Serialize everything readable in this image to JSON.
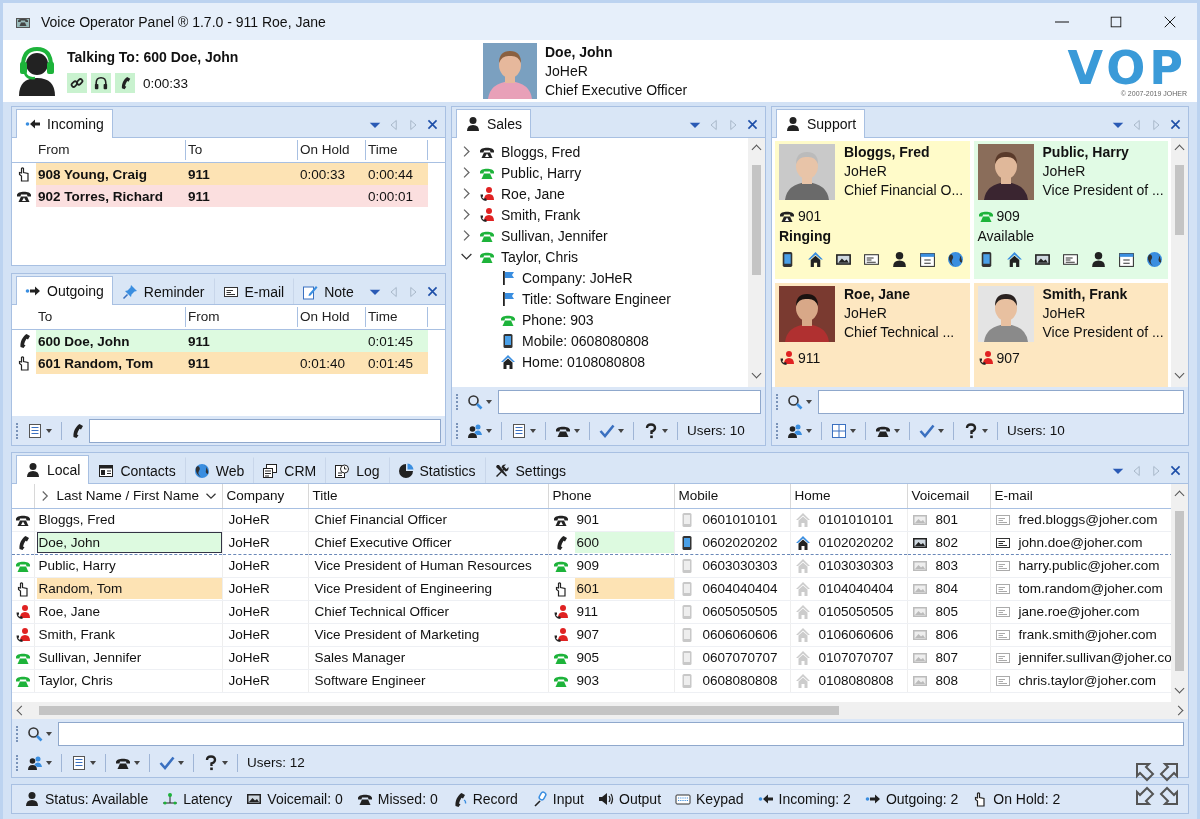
{
  "window": {
    "title": "Voice Operator Panel ® 1.7.0 - 911 Roe, Jane"
  },
  "header": {
    "talking_to": "Talking To: 600 Doe, John",
    "timer": "0:00:33",
    "contact": {
      "name": "Doe, John",
      "company": "JoHeR",
      "title": "Chief Executive Officer"
    },
    "logo": "VOP",
    "copyright": "© 2007-2019 JOHER"
  },
  "incoming": {
    "tabs": [
      {
        "label": "Incoming",
        "selected": true
      }
    ],
    "columns": [
      "From",
      "To",
      "On Hold",
      "Time"
    ],
    "rows": [
      {
        "kind": "hold",
        "from": "908 Young, Craig",
        "to": "911",
        "on_hold": "0:00:33",
        "time": "0:00:44"
      },
      {
        "kind": "ringing",
        "from": "902 Torres, Richard",
        "to": "911",
        "time": "0:00:01"
      }
    ]
  },
  "outgoing": {
    "tabs": [
      {
        "label": "Outgoing",
        "selected": true
      },
      {
        "label": "Reminder",
        "selected": false
      },
      {
        "label": "E-mail",
        "selected": false
      },
      {
        "label": "Note",
        "selected": false
      }
    ],
    "columns": [
      "To",
      "From",
      "On Hold",
      "Time"
    ],
    "rows": [
      {
        "kind": "talking",
        "to": "600 Doe, John",
        "from": "911",
        "time": "0:01:45"
      },
      {
        "kind": "hold",
        "to": "601 Random, Tom",
        "from": "911",
        "on_hold": "0:01:40",
        "time": "0:01:45"
      }
    ]
  },
  "sales": {
    "tabs": [
      {
        "label": "Sales",
        "selected": true
      }
    ],
    "items": [
      {
        "kind": "ringing",
        "name": "Bloggs, Fred",
        "expanded": false
      },
      {
        "kind": "available",
        "name": "Public, Harry",
        "expanded": false
      },
      {
        "kind": "busy",
        "name": "Roe, Jane",
        "expanded": false
      },
      {
        "kind": "busy",
        "name": "Smith, Frank",
        "expanded": false
      },
      {
        "kind": "available",
        "name": "Sullivan, Jennifer",
        "expanded": false
      },
      {
        "kind": "available",
        "name": "Taylor, Chris",
        "expanded": true,
        "children": [
          {
            "kind": "company",
            "text": "Company: JoHeR"
          },
          {
            "kind": "title",
            "text": "Title: Software Engineer"
          },
          {
            "kind": "phone",
            "text": "Phone: 903"
          },
          {
            "kind": "mobile",
            "text": "Mobile: 0608080808"
          },
          {
            "kind": "home",
            "text": "Home: 0108080808"
          }
        ]
      }
    ],
    "users": "Users: 10"
  },
  "support": {
    "tabs": [
      {
        "label": "Support",
        "selected": true
      }
    ],
    "cards": [
      {
        "kind": "ringing",
        "name": "Bloggs, Fred",
        "company": "JoHeR",
        "title": "Chief Financial O...",
        "phone": "901",
        "status_text": "Ringing"
      },
      {
        "kind": "available",
        "name": "Public, Harry",
        "company": "JoHeR",
        "title": "Vice President of ...",
        "phone": "909",
        "status_text": "Available"
      },
      {
        "kind": "busy",
        "name": "Roe, Jane",
        "company": "JoHeR",
        "title": "Chief Technical ...",
        "phone": "911"
      },
      {
        "kind": "busy",
        "name": "Smith, Frank",
        "company": "JoHeR",
        "title": "Vice President of ...",
        "phone": "907"
      }
    ],
    "users": "Users: 10"
  },
  "local": {
    "tabs": [
      {
        "label": "Local",
        "selected": true
      },
      {
        "label": "Contacts",
        "selected": false
      },
      {
        "label": "Web",
        "selected": false
      },
      {
        "label": "CRM",
        "selected": false
      },
      {
        "label": "Log",
        "selected": false
      },
      {
        "label": "Statistics",
        "selected": false
      },
      {
        "label": "Settings",
        "selected": false
      }
    ],
    "columns": [
      "Last Name / First Name",
      "Company",
      "Title",
      "Phone",
      "Mobile",
      "Home",
      "Voicemail",
      "E-mail"
    ],
    "rows": [
      {
        "kind": "ringing",
        "selected": false,
        "name": "Bloggs, Fred",
        "company": "JoHeR",
        "title": "Chief Financial Officer",
        "phone": "901",
        "mobile": "0601010101",
        "home": "0101010101",
        "voicemail": "801",
        "email": "fred.bloggs@joher.com"
      },
      {
        "kind": "talking",
        "selected": true,
        "name": "Doe, John",
        "company": "JoHeR",
        "title": "Chief Executive Officer",
        "phone": "600",
        "mobile": "0602020202",
        "home": "0102020202",
        "voicemail": "802",
        "email": "john.doe@joher.com"
      },
      {
        "kind": "available",
        "selected": false,
        "name": "Public, Harry",
        "company": "JoHeR",
        "title": "Vice President of Human Resources",
        "phone": "909",
        "mobile": "0603030303",
        "home": "0103030303",
        "voicemail": "803",
        "email": "harry.public@joher.com"
      },
      {
        "kind": "hold",
        "selected": false,
        "name": "Random, Tom",
        "company": "JoHeR",
        "title": "Vice President of Engineering",
        "phone": "601",
        "mobile": "0604040404",
        "home": "0104040404",
        "voicemail": "804",
        "email": "tom.random@joher.com"
      },
      {
        "kind": "busy",
        "selected": false,
        "name": "Roe, Jane",
        "company": "JoHeR",
        "title": "Chief Technical Officer",
        "phone": "911",
        "mobile": "0605050505",
        "home": "0105050505",
        "voicemail": "805",
        "email": "jane.roe@joher.com"
      },
      {
        "kind": "busy",
        "selected": false,
        "name": "Smith, Frank",
        "company": "JoHeR",
        "title": "Vice President of Marketing",
        "phone": "907",
        "mobile": "0606060606",
        "home": "0106060606",
        "voicemail": "806",
        "email": "frank.smith@joher.com"
      },
      {
        "kind": "available",
        "selected": false,
        "name": "Sullivan, Jennifer",
        "company": "JoHeR",
        "title": "Sales Manager",
        "phone": "905",
        "mobile": "0607070707",
        "home": "0107070707",
        "voicemail": "807",
        "email": "jennifer.sullivan@joher.co"
      },
      {
        "kind": "available",
        "selected": false,
        "name": "Taylor, Chris",
        "company": "JoHeR",
        "title": "Software Engineer",
        "phone": "903",
        "mobile": "0608080808",
        "home": "0108080808",
        "voicemail": "808",
        "email": "chris.taylor@joher.com"
      }
    ],
    "users": "Users: 12"
  },
  "status_bar": [
    "Status: Available",
    "Latency",
    "Voicemail: 0",
    "Missed: 0",
    "Record",
    "Input",
    "Output",
    "Keypad",
    "Incoming: 2",
    "Outgoing: 2",
    "On Hold: 2"
  ]
}
